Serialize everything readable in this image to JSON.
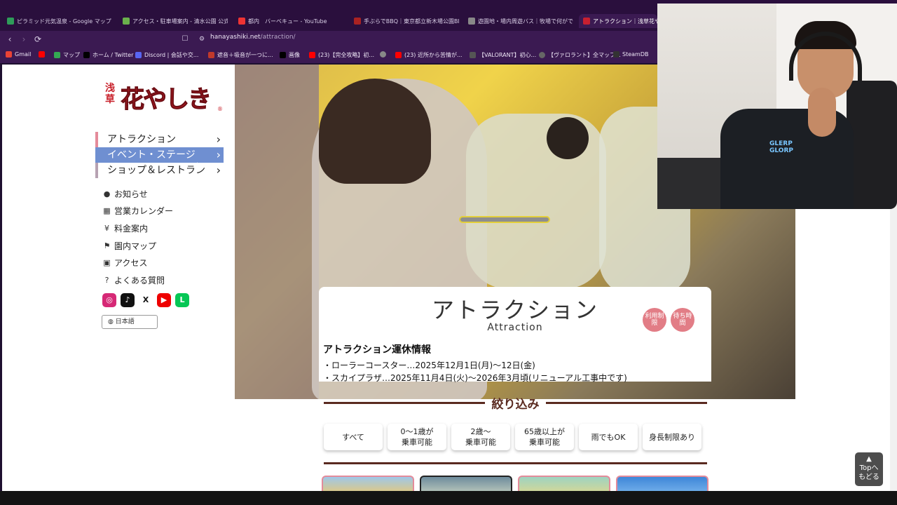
{
  "browser": {
    "tabs": [
      {
        "label": "ピラミッド元気温泉 - Google マップ",
        "color": "#2f9c5a"
      },
      {
        "label": "アクセス・駐車場案内 - 清水公園 公式",
        "color": "#6ab04c"
      },
      {
        "label": "都内　バーベキュー - YouTube",
        "color": "#e33"
      },
      {
        "label": "手ぶらでBBQ｜東京都立新木場公園BB",
        "color": "#a22"
      },
      {
        "label": "遊園地・場内周遊バス｜牧場で何ができ",
        "color": "#888"
      },
      {
        "label": "アトラクション｜浅草花やしき",
        "color": "#c82030",
        "active": true
      }
    ],
    "back_label": "‹",
    "forward_label": "›",
    "reload_label": "⟳",
    "url_host": "hanayashiki.net",
    "url_path": "/attraction/",
    "bookmarks": [
      {
        "label": "Gmail",
        "color": "#ea4335"
      },
      {
        "label": "",
        "color": "#ff0000"
      },
      {
        "label": "マップ",
        "color": "#34a853"
      },
      {
        "label": "ホーム / Twitter",
        "color": "#000"
      },
      {
        "label": "Discord | 会話や交...",
        "color": "#5865f2"
      },
      {
        "label": "遮音＋吸音が一つに...",
        "color": "#c0392b"
      },
      {
        "label": "画像",
        "color": "#000"
      },
      {
        "label": "(23)【完全攻略】初...",
        "color": "#ff0000"
      },
      {
        "label": "",
        "color": "#888"
      },
      {
        "label": "(23) 近所から苦情が...",
        "color": "#ff0000"
      },
      {
        "label": "【VALORANT】初心...",
        "color": "#555"
      },
      {
        "label": "【ヴァロラント】全マップ...",
        "color": "#666"
      },
      {
        "label": "SteamDB",
        "color": "#333"
      }
    ]
  },
  "logo": {
    "small": "浅草",
    "big": "花やしき",
    "reg": "®"
  },
  "nav_main": [
    {
      "label": "アトラクション",
      "chev": "›"
    },
    {
      "label": "イベント・ステージ",
      "chev": "›"
    },
    {
      "label": "ショップ＆レストラン",
      "chev": "›"
    }
  ],
  "nav_sub": [
    {
      "label": "お知らせ",
      "icon": "chat-icon",
      "glyph": "●"
    },
    {
      "label": "営業カレンダー",
      "icon": "calendar-icon",
      "glyph": "▦"
    },
    {
      "label": "料金案内",
      "icon": "yen-icon",
      "glyph": "¥"
    },
    {
      "label": "園内マップ",
      "icon": "map-icon",
      "glyph": "⚑"
    },
    {
      "label": "アクセス",
      "icon": "train-icon",
      "glyph": "▣"
    },
    {
      "label": "よくある質問",
      "icon": "help-icon",
      "glyph": "?"
    }
  ],
  "social": [
    {
      "name": "instagram-icon",
      "glyph": "◎",
      "color": "#d62976"
    },
    {
      "name": "tiktok-icon",
      "glyph": "♪",
      "color": "#111"
    },
    {
      "name": "x-icon",
      "glyph": "X",
      "color": "#111"
    },
    {
      "name": "youtube-icon",
      "glyph": "▶",
      "color": "#e00"
    },
    {
      "name": "line-icon",
      "glyph": "L",
      "color": "#06c755"
    }
  ],
  "language": "日本語",
  "hero": {
    "title": "アトラクション",
    "subtitle": "Attraction",
    "badges": [
      "利用制限",
      "待ち時間"
    ]
  },
  "notice": {
    "heading": "アトラクション運休情報",
    "lines": [
      "・ローラーコースター…2025年12月1日(月)〜12日(金)",
      "・スカイプラザ…2025年11月4日(火)〜2026年3月頃(リニューアル工事中です)"
    ]
  },
  "filter": {
    "title": "絞り込み",
    "buttons": [
      "すべて",
      "0〜1歳が\n乗車可能",
      "2歳〜\n乗車可能",
      "65歳以上が\n乗車可能",
      "雨でもOK",
      "身長制限あり"
    ]
  },
  "top_button": {
    "arrow": "▲",
    "label": "Topへ\nもどる"
  },
  "webcam": {
    "shirt_text": "GLERP\nGLORP"
  }
}
